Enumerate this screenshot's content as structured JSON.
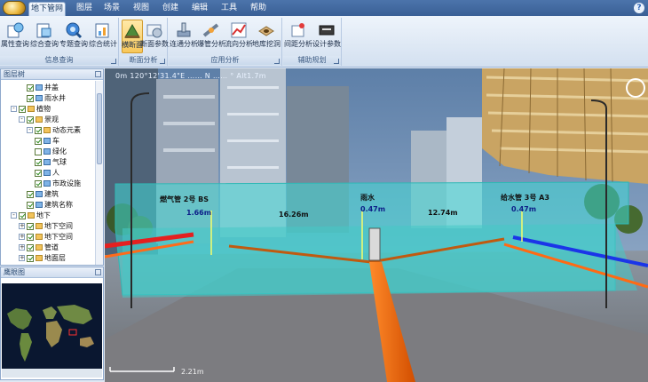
{
  "tabs": [
    {
      "label": "地下管网",
      "active": true
    },
    {
      "label": "图层",
      "active": false
    },
    {
      "label": "场景",
      "active": false
    },
    {
      "label": "视图",
      "active": false
    },
    {
      "label": "创建",
      "active": false
    },
    {
      "label": "编辑",
      "active": false
    },
    {
      "label": "工具",
      "active": false
    },
    {
      "label": "帮助",
      "active": false
    }
  ],
  "window": {
    "help_glyph": "?"
  },
  "ribbon": {
    "groups": [
      {
        "label": "信息查询",
        "buttons": [
          {
            "label": "属性查询",
            "icon": "property-query-icon"
          },
          {
            "label": "综合查询",
            "icon": "composite-query-icon"
          },
          {
            "label": "专题查询",
            "icon": "topic-query-icon"
          },
          {
            "label": "综合统计",
            "icon": "statistics-icon"
          }
        ]
      },
      {
        "label": "断面分析",
        "buttons": [
          {
            "label": "横断面",
            "icon": "cross-section-icon",
            "pressed": true
          },
          {
            "label": "断面参数",
            "icon": "section-params-icon"
          }
        ]
      },
      {
        "label": "应用分析",
        "buttons": [
          {
            "label": "连通分析",
            "icon": "connectivity-icon"
          },
          {
            "label": "爆管分析",
            "icon": "pipe-burst-icon"
          },
          {
            "label": "流向分析",
            "icon": "flow-direction-icon"
          },
          {
            "label": "地库挖洞",
            "icon": "dig-hole-icon"
          }
        ]
      },
      {
        "label": "辅助规划",
        "buttons": [
          {
            "label": "间距分析",
            "icon": "spacing-icon"
          },
          {
            "label": "设计参数",
            "icon": "design-params-icon"
          }
        ]
      }
    ]
  },
  "layer_panel": {
    "title": "图层树",
    "items": [
      {
        "label": "井盖",
        "depth": 3,
        "checked": true,
        "expander": ""
      },
      {
        "label": "雨水井",
        "depth": 3,
        "checked": true,
        "expander": ""
      },
      {
        "label": "植物",
        "depth": 1,
        "checked": true,
        "expander": "-"
      },
      {
        "label": "景观",
        "depth": 2,
        "checked": true,
        "expander": "-"
      },
      {
        "label": "动态元素",
        "depth": 3,
        "checked": true,
        "expander": "-"
      },
      {
        "label": "车",
        "depth": 4,
        "checked": true,
        "expander": ""
      },
      {
        "label": "绿化",
        "depth": 4,
        "checked": false,
        "expander": ""
      },
      {
        "label": "气球",
        "depth": 4,
        "checked": true,
        "expander": ""
      },
      {
        "label": "人",
        "depth": 4,
        "checked": true,
        "expander": ""
      },
      {
        "label": "市政设施",
        "depth": 4,
        "checked": true,
        "expander": ""
      },
      {
        "label": "建筑",
        "depth": 3,
        "checked": true,
        "expander": ""
      },
      {
        "label": "建筑名称",
        "depth": 3,
        "checked": true,
        "expander": ""
      },
      {
        "label": "地下",
        "depth": 1,
        "checked": true,
        "expander": "-"
      },
      {
        "label": "地下空间",
        "depth": 2,
        "checked": true,
        "expander": "+"
      },
      {
        "label": "地下空间",
        "depth": 2,
        "checked": true,
        "expander": "+"
      },
      {
        "label": "管道",
        "depth": 2,
        "checked": true,
        "expander": "+"
      },
      {
        "label": "地面层",
        "depth": 2,
        "checked": true,
        "expander": "+"
      }
    ]
  },
  "overview_panel": {
    "title": "鹰眼图"
  },
  "viewport": {
    "status": "0m 120°12'31.4\"E  ……  N  …… °  Alt1.7m",
    "measurements": [
      {
        "text": "燃气管 2号 BS"
      },
      {
        "text": "1.66m"
      },
      {
        "text": "16.26m"
      },
      {
        "text": "雨水"
      },
      {
        "text": "0.47m"
      },
      {
        "text": "12.74m"
      },
      {
        "text": "给水管 3号 A3"
      },
      {
        "text": "0.47m"
      }
    ],
    "scale_label": "2.21m"
  }
}
